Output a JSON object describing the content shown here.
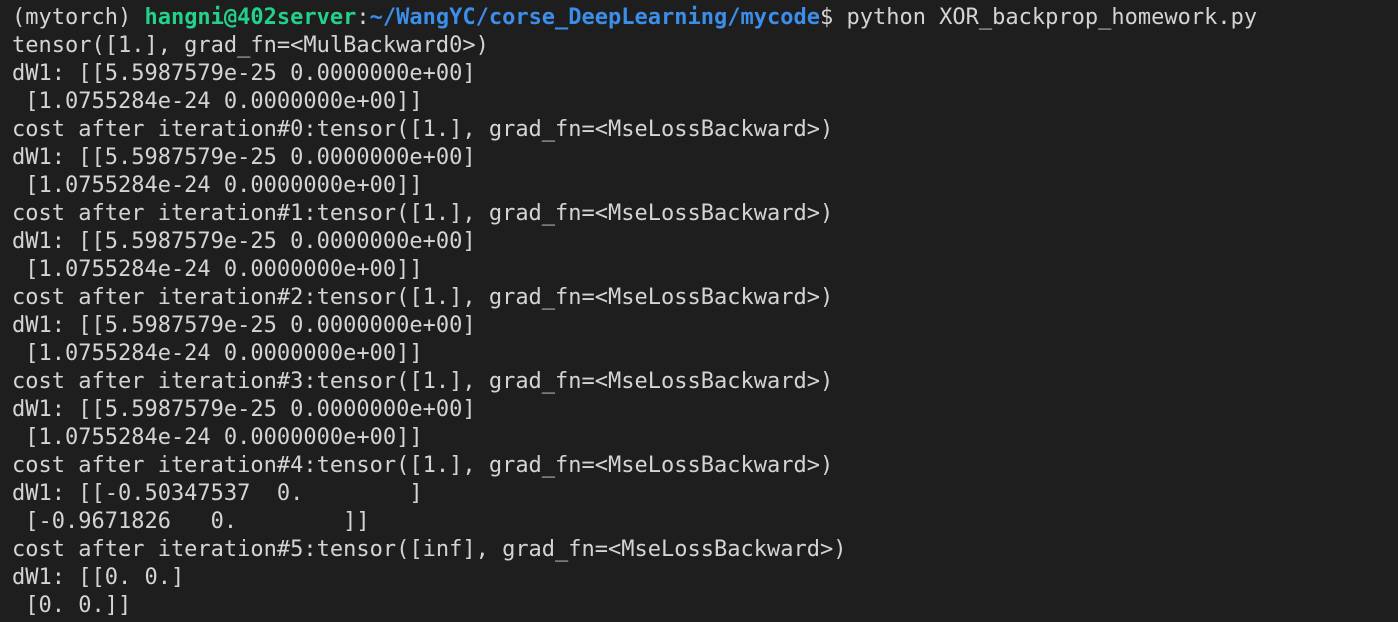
{
  "prompt": {
    "env": "(mytorch) ",
    "user_host": "hangni@402server",
    "separator": ":",
    "path": "~/WangYC/corse_DeepLearning/mycode",
    "dollar": "$",
    "command": " python XOR_backprop_homework.py"
  },
  "output_lines": [
    "tensor([1.], grad_fn=<MulBackward0>)",
    "dW1: [[5.5987579e-25 0.0000000e+00]",
    " [1.0755284e-24 0.0000000e+00]]",
    "cost after iteration#0:tensor([1.], grad_fn=<MseLossBackward>)",
    "dW1: [[5.5987579e-25 0.0000000e+00]",
    " [1.0755284e-24 0.0000000e+00]]",
    "cost after iteration#1:tensor([1.], grad_fn=<MseLossBackward>)",
    "dW1: [[5.5987579e-25 0.0000000e+00]",
    " [1.0755284e-24 0.0000000e+00]]",
    "cost after iteration#2:tensor([1.], grad_fn=<MseLossBackward>)",
    "dW1: [[5.5987579e-25 0.0000000e+00]",
    " [1.0755284e-24 0.0000000e+00]]",
    "cost after iteration#3:tensor([1.], grad_fn=<MseLossBackward>)",
    "dW1: [[5.5987579e-25 0.0000000e+00]",
    " [1.0755284e-24 0.0000000e+00]]",
    "cost after iteration#4:tensor([1.], grad_fn=<MseLossBackward>)",
    "dW1: [[-0.50347537  0.        ]",
    " [-0.9671826   0.        ]]",
    "cost after iteration#5:tensor([inf], grad_fn=<MseLossBackward>)",
    "dW1: [[0. 0.]",
    " [0. 0.]]"
  ],
  "colors": {
    "background": "#1e1e1e",
    "text": "#d4d4d4",
    "user_host": "#23d18b",
    "path": "#3b8eea"
  }
}
